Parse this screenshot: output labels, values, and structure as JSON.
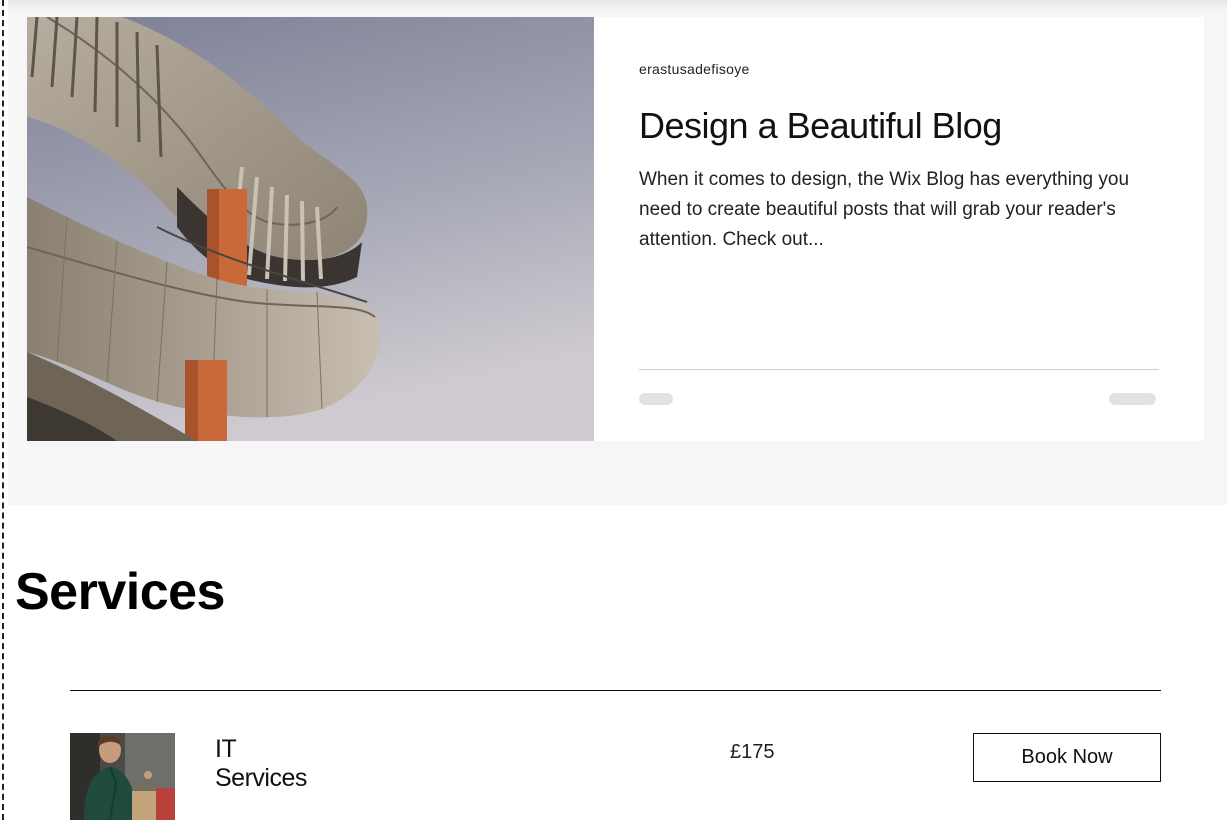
{
  "blog": {
    "author": "erastusadefisoye",
    "title": "Design a Beautiful Blog",
    "excerpt": "When it comes to design, the Wix Blog has everything you need to create beautiful posts that will grab your reader's attention. Check out..."
  },
  "services": {
    "heading": "Services",
    "items": [
      {
        "name": "IT Services",
        "price": "£175",
        "button_label": "Book Now"
      }
    ]
  },
  "colors": {
    "section_bg": "#f6f6f6",
    "card_bg": "#ffffff",
    "accent_orange": "#c9693a",
    "text": "#111111"
  }
}
